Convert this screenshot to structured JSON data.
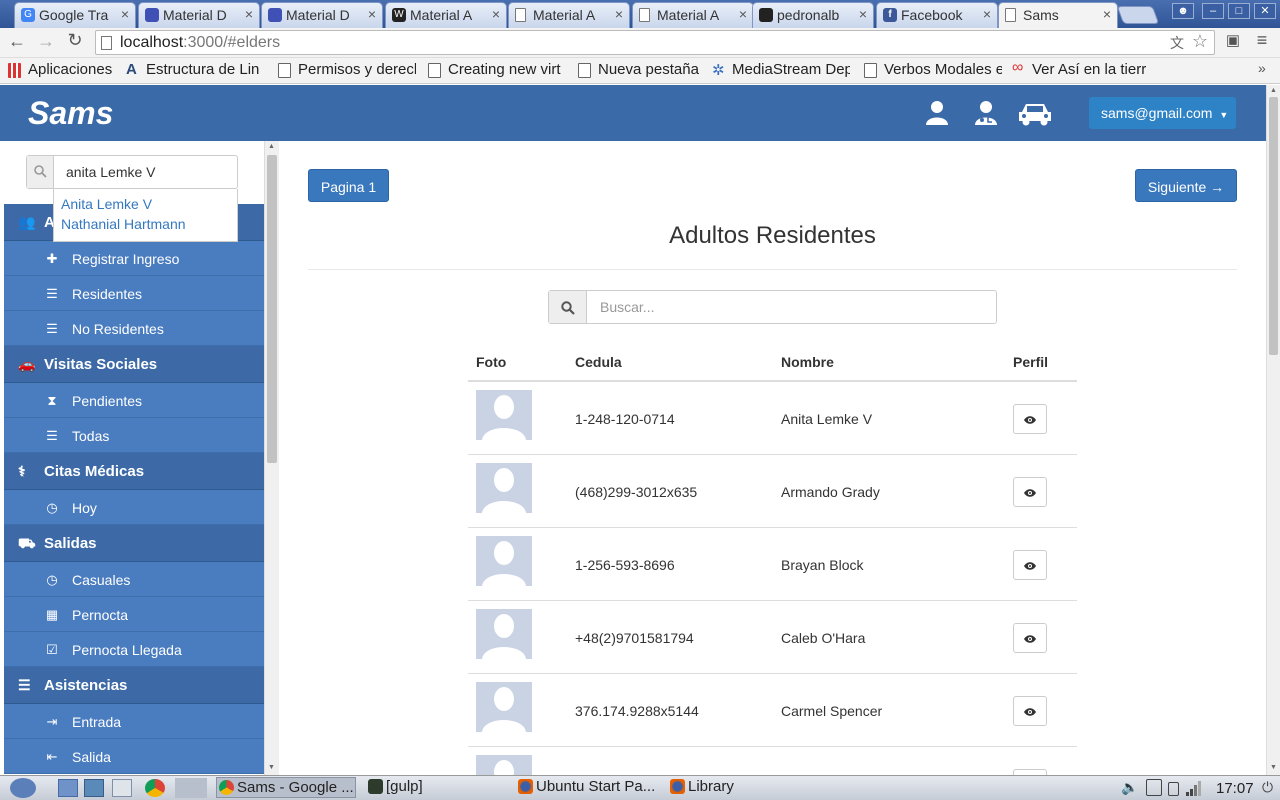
{
  "browser": {
    "tabs": [
      {
        "title": "Google Tra",
        "icon": "google-translate-icon",
        "color": "#4285f4"
      },
      {
        "title": "Material D",
        "icon": "material-icon",
        "color": "#3f51b5"
      },
      {
        "title": "Material D",
        "icon": "material-icon",
        "color": "#3f51b5"
      },
      {
        "title": "Material A",
        "icon": "w-icon",
        "color": "#222222"
      },
      {
        "title": "Material A",
        "icon": "page-icon",
        "color": "#ffffff"
      },
      {
        "title": "Material A",
        "icon": "page-icon",
        "color": "#ffffff"
      },
      {
        "title": "pedronalb",
        "icon": "github-icon",
        "color": "#222222"
      },
      {
        "title": "Facebook",
        "icon": "facebook-icon",
        "color": "#3b5998"
      },
      {
        "title": "Sams",
        "icon": "page-icon",
        "color": "#ffffff",
        "active": true
      }
    ],
    "url_host": "localhost",
    "url_path": ":3000/#elders",
    "bookmarks": [
      {
        "label": "Aplicaciones",
        "icon": "apps-grid-icon"
      },
      {
        "label": "Estructura de Lin",
        "icon": "a-icon"
      },
      {
        "label": "Permisos y derecl",
        "icon": "page-icon"
      },
      {
        "label": "Creating new virt",
        "icon": "page-icon"
      },
      {
        "label": "Nueva pestaña",
        "icon": "page-icon"
      },
      {
        "label": "MediaStream Dep",
        "icon": "gear-icon"
      },
      {
        "label": "Verbos Modales e",
        "icon": "page-icon"
      },
      {
        "label": "Ver Así en la tierr",
        "icon": "infinity-icon"
      }
    ]
  },
  "app": {
    "brand": "Sams",
    "user_email": "sams@gmail.com",
    "accent": "#3a6aa8"
  },
  "sidebar": {
    "search_value": "anita Lemke V",
    "suggestions": [
      "Anita Lemke V",
      "Nathanial Hartmann"
    ],
    "sections": [
      {
        "title": "Adultos",
        "icon": "users-icon",
        "items": [
          {
            "label": "Registrar Ingreso",
            "icon": "plus-icon"
          },
          {
            "label": "Residentes",
            "icon": "list-icon"
          },
          {
            "label": "No Residentes",
            "icon": "list-icon"
          }
        ]
      },
      {
        "title": "Visitas Sociales",
        "icon": "car-icon",
        "items": [
          {
            "label": "Pendientes",
            "icon": "hourglass-icon"
          },
          {
            "label": "Todas",
            "icon": "list-icon"
          }
        ]
      },
      {
        "title": "Citas Médicas",
        "icon": "user-md-icon",
        "items": [
          {
            "label": "Hoy",
            "icon": "clock-icon"
          }
        ]
      },
      {
        "title": "Salidas",
        "icon": "road-icon",
        "items": [
          {
            "label": "Casuales",
            "icon": "clock-icon"
          },
          {
            "label": "Pernocta",
            "icon": "calendar-icon"
          },
          {
            "label": "Pernocta Llegada",
            "icon": "calendar-check-icon"
          }
        ]
      },
      {
        "title": "Asistencias",
        "icon": "list-alt-icon",
        "items": [
          {
            "label": "Entrada",
            "icon": "sign-in-icon"
          },
          {
            "label": "Salida",
            "icon": "sign-out-icon"
          }
        ]
      }
    ]
  },
  "main": {
    "page_button": "Pagina 1",
    "next_button": "Siguiente →",
    "title": "Adultos Residentes",
    "search_placeholder": "Buscar...",
    "columns": [
      "Foto",
      "Cedula",
      "Nombre",
      "Perfil"
    ],
    "rows": [
      {
        "cedula": "1-248-120-0714",
        "nombre": "Anita Lemke V"
      },
      {
        "cedula": "(468)299-3012x635",
        "nombre": "Armando Grady"
      },
      {
        "cedula": "1-256-593-8696",
        "nombre": "Brayan Block"
      },
      {
        "cedula": "+48(2)9701581794",
        "nombre": "Caleb O'Hara"
      },
      {
        "cedula": "376.174.9288x5144",
        "nombre": "Carmel Spencer"
      },
      {
        "cedula": "",
        "nombre": ""
      }
    ]
  },
  "taskbar": {
    "tasks": [
      {
        "label": "Sams - Google ...",
        "icon": "chrome-icon"
      },
      {
        "label": "[gulp]",
        "icon": "terminal-icon"
      },
      {
        "label": "Ubuntu Start Pa...",
        "icon": "firefox-icon"
      },
      {
        "label": "Library",
        "icon": "firefox-icon"
      }
    ],
    "clock": "17:07"
  }
}
